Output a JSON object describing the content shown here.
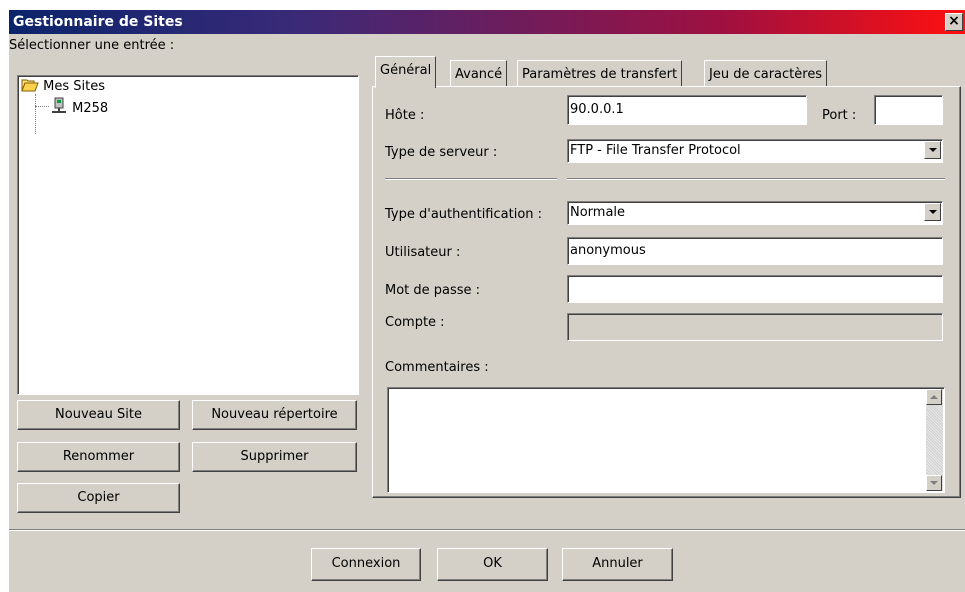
{
  "window": {
    "title": "Gestionnaire de Sites",
    "close_glyph": "×"
  },
  "left": {
    "select_label": "Sélectionner une entrée :",
    "tree": [
      {
        "label": "Mes Sites",
        "icon": "folder-open-icon"
      },
      {
        "label": "M258",
        "icon": "server-icon"
      }
    ],
    "buttons": {
      "new_site": "Nouveau Site",
      "new_folder": "Nouveau répertoire",
      "rename": "Renommer",
      "delete": "Supprimer",
      "copy": "Copier"
    }
  },
  "tabs": [
    "Général",
    "Avancé",
    "Paramètres de transfert",
    "Jeu de caractères"
  ],
  "general": {
    "host_label": "Hôte :",
    "host_value": "90.0.0.1",
    "port_label": "Port :",
    "port_value": "",
    "server_type_label": "Type de serveur :",
    "server_type_value": "FTP - File Transfer Protocol",
    "auth_type_label": "Type d'authentification :",
    "auth_type_value": "Normale",
    "user_label": "Utilisateur :",
    "user_value": "anonymous",
    "password_label": "Mot de passe :",
    "password_value": "",
    "account_label": "Compte :",
    "account_value": "",
    "comments_label": "Commentaires :",
    "comments_value": ""
  },
  "footer": {
    "connect": "Connexion",
    "ok": "OK",
    "cancel": "Annuler"
  }
}
